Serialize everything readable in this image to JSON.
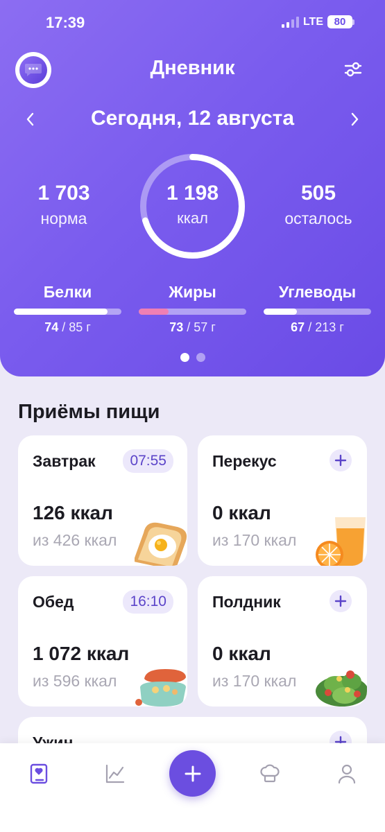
{
  "status_bar": {
    "time": "17:39",
    "network": "LTE",
    "battery": "80"
  },
  "header": {
    "title": "Дневник",
    "date": "Сегодня,  12 августа"
  },
  "summary": {
    "norm_value": "1 703",
    "norm_label": "норма",
    "consumed_value": "1 198",
    "consumed_label": "ккал",
    "consumed_fraction": 0.703,
    "remaining_value": "505",
    "remaining_label": "осталось"
  },
  "macros": [
    {
      "name": "Белки",
      "eaten": "74",
      "rest": " / 85 г",
      "fraction": 0.87,
      "fill_color": "#ffffff"
    },
    {
      "name": "Жиры",
      "eaten": "73",
      "rest": " / 57 г",
      "fraction": 0.28,
      "fill_color": "#ef7fb4"
    },
    {
      "name": "Углеводы",
      "eaten": "67",
      "rest": " / 213 г",
      "fraction": 0.31,
      "fill_color": "#ffffff"
    }
  ],
  "pager": {
    "count": 2,
    "active": 0
  },
  "meals_section": {
    "title": "Приёмы пищи"
  },
  "meals": [
    {
      "name": "Завтрак",
      "time": "07:55",
      "kcal": "126 ккал",
      "of": "из 426 ккал",
      "icon": "toast-egg-icon"
    },
    {
      "name": "Перекус",
      "time": "",
      "kcal": "0 ккал",
      "of": "из 170 ккал",
      "icon": "juice-icon"
    },
    {
      "name": "Обед",
      "time": "16:10",
      "kcal": "1 072 ккал",
      "of": "из 596 ккал",
      "icon": "lunchbox-icon"
    },
    {
      "name": "Полдник",
      "time": "",
      "kcal": "0 ккал",
      "of": "из 170 ккал",
      "icon": "salad-icon"
    },
    {
      "name": "Ужин",
      "time": "",
      "kcal": "",
      "of": "",
      "icon": ""
    }
  ],
  "tabbar": {
    "items": [
      "diary-icon",
      "stats-icon",
      "add-icon",
      "recipes-icon",
      "profile-icon"
    ],
    "active": "diary-icon"
  },
  "colors": {
    "accent": "#6b4ee0",
    "hero_gradient_start": "#8c6df2",
    "hero_gradient_end": "#6a4be6",
    "background": "#ece9f7"
  }
}
